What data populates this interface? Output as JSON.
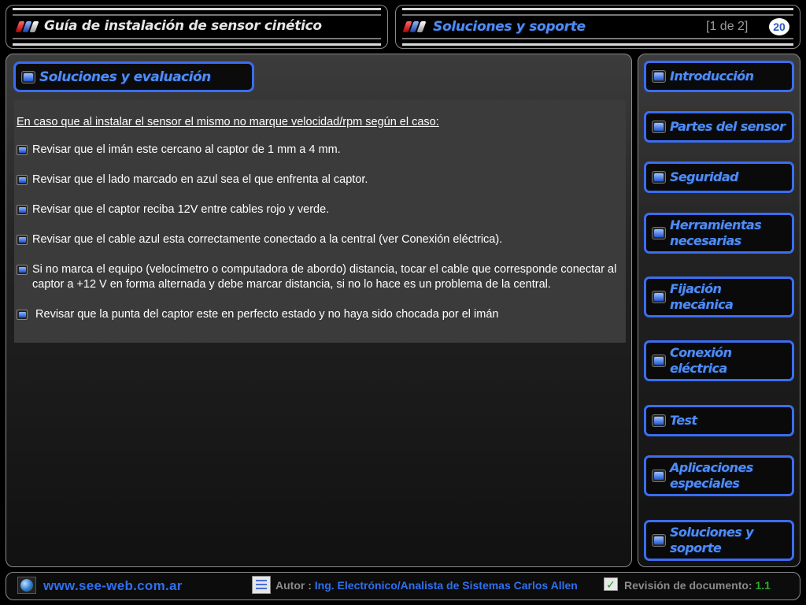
{
  "header": {
    "left_title": "Guía de instalación de sensor cinético",
    "right_title": "Soluciones y soporte",
    "page_indicator": "[1 de 2]",
    "page_number": "20"
  },
  "main": {
    "heading": "Soluciones y evaluación",
    "intro": "En caso que al instalar el sensor el mismo no marque velocidad/rpm según el caso:",
    "bullets": [
      "Revisar que el imán este cercano al captor de 1 mm a 4 mm.",
      "Revisar que el lado marcado en azul sea el que enfrenta al captor.",
      "Revisar que el captor reciba 12V entre cables rojo y verde.",
      "Revisar que el cable azul esta correctamente conectado a la central (ver Conexión eléctrica).",
      "Si no marca el equipo (velocímetro o computadora de abordo) distancia, tocar el cable que corresponde conectar al captor a +12 V en forma alternada y debe marcar distancia, si no lo hace es un problema de la central.",
      " Revisar que la punta del captor este en perfecto estado y no haya sido chocada por el imán"
    ]
  },
  "sidebar": {
    "items": [
      {
        "label": "Introducción"
      },
      {
        "label": "Partes del sensor"
      },
      {
        "label": "Seguridad"
      },
      {
        "label": "Herramientas necesarias"
      },
      {
        "label": "Fijación mecánica"
      },
      {
        "label": "Conexión eléctrica"
      },
      {
        "label": "Test"
      },
      {
        "label": "Aplicaciones especiales"
      },
      {
        "label": "Soluciones y soporte"
      }
    ]
  },
  "footer": {
    "website": "www.see-web.com.ar",
    "author_label": "Autor :",
    "author_value": "Ing. Electrónico/Analista de Sistemas Carlos Allen",
    "revision_label": "Revisión de documento:",
    "revision_value": "1.1"
  },
  "colors": {
    "accent_blue": "#3a6df0",
    "heading_blue": "#4f8cf5",
    "revision_green": "#2aaa2a"
  }
}
